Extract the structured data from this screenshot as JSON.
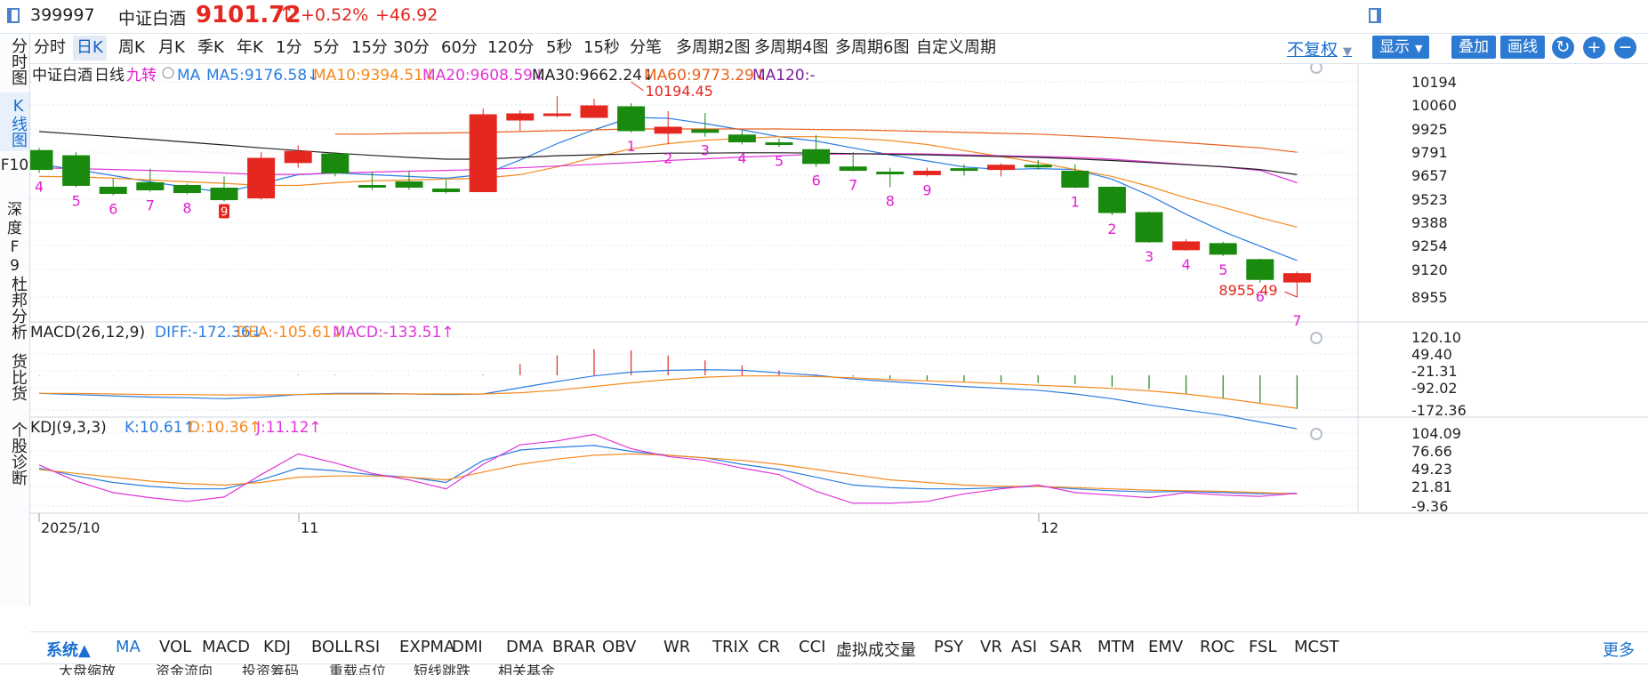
{
  "header": {
    "code": "399997",
    "name": "中证白酒",
    "price": "9101.72",
    "arrow": "↑",
    "pct": "+0.52%",
    "change": "+46.92"
  },
  "timeframes": [
    "分时",
    "日K",
    "周K",
    "月K",
    "季K",
    "年K",
    "1分",
    "5分",
    "15分",
    "30分",
    "60分",
    "120分",
    "5秒",
    "15秒",
    "分笔",
    "多周期2图",
    "多周期4图",
    "多周期6图",
    "自定义周期"
  ],
  "active_timeframe": "日K",
  "toolbar": {
    "adjust": "不复权",
    "display": "显示",
    "overlay": "叠加",
    "draw": "画线"
  },
  "sidebar": [
    {
      "label": "分时图",
      "active": false
    },
    {
      "label": "K线图",
      "active": true
    },
    {
      "label": "F10",
      "active": false
    },
    {
      "label": "深度F9",
      "active": false
    },
    {
      "label": "杜邦分析",
      "active": false
    },
    {
      "label": "货比货",
      "active": false
    },
    {
      "label": "个股诊断",
      "active": false
    }
  ],
  "ma_legend": {
    "name": "中证白酒",
    "period": "日线",
    "sig": "九转",
    "ma": "MA",
    "ma5": "MA5:9176.58↓",
    "ma10": "MA10:9394.51↓",
    "ma20": "MA20:9608.59↓",
    "ma30": "MA30:9662.24↓",
    "ma60": "MA60:9773.29↓",
    "ma120": "MA120:-"
  },
  "macd_legend": {
    "name": "MACD(26,12,9)",
    "diff": "DIFF:-172.36↓",
    "dea": "DEA:-105.61↓",
    "macd": "MACD:-133.51↑"
  },
  "kdj_legend": {
    "name": "KDJ(9,3,3)",
    "k": "K:10.61↑",
    "d": "D:10.36↑",
    "j": "J:11.12↑"
  },
  "date_labels": [
    "2025/10",
    "11",
    "12"
  ],
  "indicator_tabs": [
    "MA",
    "VOL",
    "MACD",
    "KDJ",
    "BOLL",
    "RSI",
    "EXPMA",
    "DMI",
    "DMA",
    "BRAR",
    "OBV",
    "WR",
    "TRIX",
    "CR",
    "CCI",
    "虚拟成交量",
    "PSY",
    "VR",
    "ASI",
    "SAR",
    "MTM",
    "EMV",
    "ROC",
    "FSL",
    "MCST"
  ],
  "system_label": "系统▲",
  "more_label": "更多",
  "subtabs": [
    "大盘缩放",
    "资金流向",
    "投资筹码",
    "重载点位",
    "短线跳跌",
    "相关基金"
  ],
  "colors": {
    "up": "#e4271f",
    "down": "#1a8a0f",
    "ma5": "#2a7de1",
    "ma10": "#f58a1f",
    "ma20": "#e035d8",
    "ma30": "#222222",
    "ma60": "#e8611c",
    "ma120": "#7a1f9b",
    "nine": "#e020d0"
  },
  "chart_data": [
    {
      "type": "candlestick",
      "title": "中证白酒 日线",
      "y_ticks": [
        "10194",
        "10060",
        "9925",
        "9791",
        "9657",
        "9523",
        "9388",
        "9254",
        "9120",
        "8955"
      ],
      "ylim": [
        8900,
        10250
      ],
      "max_label": "10194.45",
      "min_label": "8955.49",
      "candles": [
        {
          "o": 9800,
          "c": 9690,
          "h": 9815,
          "l": 9670
        },
        {
          "o": 9770,
          "c": 9600,
          "h": 9790,
          "l": 9590
        },
        {
          "o": 9590,
          "c": 9555,
          "h": 9640,
          "l": 9545
        },
        {
          "o": 9615,
          "c": 9575,
          "h": 9695,
          "l": 9565
        },
        {
          "o": 9600,
          "c": 9560,
          "h": 9610,
          "l": 9550
        },
        {
          "o": 9585,
          "c": 9520,
          "h": 9650,
          "l": 9510
        },
        {
          "o": 9530,
          "c": 9755,
          "h": 9790,
          "l": 9520
        },
        {
          "o": 9730,
          "c": 9795,
          "h": 9830,
          "l": 9700
        },
        {
          "o": 9780,
          "c": 9670,
          "h": 9790,
          "l": 9650
        },
        {
          "o": 9600,
          "c": 9590,
          "h": 9675,
          "l": 9575
        },
        {
          "o": 9620,
          "c": 9590,
          "h": 9680,
          "l": 9575
        },
        {
          "o": 9580,
          "c": 9565,
          "h": 9630,
          "l": 9555
        },
        {
          "o": 9565,
          "c": 10005,
          "h": 10040,
          "l": 9565
        },
        {
          "o": 9975,
          "c": 10010,
          "h": 10030,
          "l": 9915
        },
        {
          "o": 10000,
          "c": 10010,
          "h": 10110,
          "l": 9990
        },
        {
          "o": 9990,
          "c": 10055,
          "h": 10095,
          "l": 9990
        },
        {
          "o": 10050,
          "c": 9915,
          "h": 10070,
          "l": 9905
        },
        {
          "o": 9900,
          "c": 9935,
          "h": 10025,
          "l": 9835
        },
        {
          "o": 9920,
          "c": 9905,
          "h": 10015,
          "l": 9880
        },
        {
          "o": 9890,
          "c": 9850,
          "h": 9915,
          "l": 9835
        },
        {
          "o": 9845,
          "c": 9835,
          "h": 9870,
          "l": 9820
        },
        {
          "o": 9805,
          "c": 9725,
          "h": 9890,
          "l": 9705
        },
        {
          "o": 9705,
          "c": 9685,
          "h": 9790,
          "l": 9680
        },
        {
          "o": 9675,
          "c": 9670,
          "h": 9700,
          "l": 9590
        },
        {
          "o": 9660,
          "c": 9680,
          "h": 9700,
          "l": 9650
        },
        {
          "o": 9695,
          "c": 9690,
          "h": 9720,
          "l": 9655
        },
        {
          "o": 9690,
          "c": 9715,
          "h": 9725,
          "l": 9650
        },
        {
          "o": 9715,
          "c": 9705,
          "h": 9745,
          "l": 9690
        },
        {
          "o": 9680,
          "c": 9590,
          "h": 9720,
          "l": 9585
        },
        {
          "o": 9590,
          "c": 9445,
          "h": 9595,
          "l": 9430
        },
        {
          "o": 9445,
          "c": 9275,
          "h": 9450,
          "l": 9270
        },
        {
          "o": 9230,
          "c": 9275,
          "h": 9290,
          "l": 9225
        },
        {
          "o": 9265,
          "c": 9205,
          "h": 9275,
          "l": 9195
        },
        {
          "o": 9175,
          "c": 9060,
          "h": 9180,
          "l": 9040
        },
        {
          "o": 9045,
          "c": 9095,
          "h": 9108,
          "l": 8955
        }
      ],
      "nine_counts": [
        "4",
        "5",
        "6",
        "7",
        "8",
        "9",
        "",
        "",
        "",
        "",
        "",
        "",
        "",
        "",
        "",
        "",
        "1",
        "2",
        "3",
        "4",
        "5",
        "6",
        "7",
        "8",
        "9",
        "",
        "",
        "",
        "1",
        "2",
        "3",
        "4",
        "5",
        "6",
        "7"
      ],
      "series": [
        {
          "name": "MA5",
          "color": "#2a7de1",
          "values": [
            9720,
            9690,
            9655,
            9620,
            9590,
            9560,
            9610,
            9660,
            9670,
            9660,
            9650,
            9640,
            9660,
            9745,
            9840,
            9920,
            9990,
            9985,
            9955,
            9920,
            9880,
            9855,
            9815,
            9775,
            9740,
            9705,
            9690,
            9695,
            9690,
            9635,
            9545,
            9435,
            9335,
            9250,
            9170
          ]
        },
        {
          "name": "MA10",
          "color": "#f58a1f",
          "values": [
            9650,
            9648,
            9640,
            9630,
            9620,
            9612,
            9600,
            9600,
            9615,
            9625,
            9630,
            9635,
            9640,
            9660,
            9705,
            9760,
            9810,
            9840,
            9860,
            9870,
            9880,
            9880,
            9872,
            9858,
            9835,
            9800,
            9765,
            9730,
            9690,
            9650,
            9595,
            9530,
            9475,
            9415,
            9360
          ]
        },
        {
          "name": "MA20",
          "color": "#e035d8",
          "values": [
            9700,
            9695,
            9690,
            9685,
            9678,
            9670,
            9660,
            9662,
            9670,
            9675,
            9680,
            9685,
            9690,
            9700,
            9710,
            9720,
            9730,
            9742,
            9752,
            9762,
            9770,
            9778,
            9780,
            9782,
            9780,
            9775,
            9770,
            9765,
            9760,
            9750,
            9735,
            9720,
            9705,
            9685,
            9615
          ]
        },
        {
          "name": "MA30",
          "color": "#222222",
          "values": [
            9910,
            9895,
            9880,
            9865,
            9848,
            9832,
            9815,
            9800,
            9785,
            9772,
            9760,
            9750,
            9750,
            9760,
            9770,
            9775,
            9780,
            9785,
            9785,
            9787,
            9787,
            9785,
            9782,
            9778,
            9775,
            9770,
            9765,
            9760,
            9752,
            9742,
            9730,
            9718,
            9706,
            9690,
            9660
          ]
        },
        {
          "name": "MA60",
          "color": "#e8611c",
          "values": [
            null,
            null,
            null,
            null,
            null,
            null,
            null,
            null,
            9895,
            9895,
            9900,
            9902,
            9905,
            9910,
            9915,
            9920,
            9925,
            9925,
            9925,
            9925,
            9925,
            9922,
            9920,
            9915,
            9910,
            9905,
            9900,
            9895,
            9885,
            9875,
            9860,
            9845,
            9830,
            9815,
            9790
          ]
        }
      ]
    },
    {
      "type": "bar",
      "title": "MACD(26,12,9)",
      "y_ticks": [
        "120.10",
        "49.40",
        "-21.31",
        "-92.02",
        "-172.36"
      ],
      "ylim": [
        -200,
        140
      ],
      "macd": [
        -2,
        -1,
        -1,
        -1,
        -1,
        -1,
        1,
        2,
        2,
        1,
        1,
        1,
        3,
        45,
        80,
        105,
        100,
        80,
        60,
        40,
        20,
        5,
        -5,
        -15,
        -20,
        -25,
        -28,
        -30,
        -35,
        -45,
        -55,
        -75,
        -95,
        -110,
        -135
      ],
      "series": [
        {
          "name": "DIFF",
          "color": "#2a7de1",
          "values": [
            -58,
            -62,
            -66,
            -70,
            -72,
            -75,
            -70,
            -62,
            -58,
            -58,
            -60,
            -62,
            -60,
            -40,
            -20,
            -2,
            10,
            16,
            18,
            16,
            8,
            0,
            -12,
            -20,
            -28,
            -36,
            -42,
            -48,
            -60,
            -75,
            -95,
            -112,
            -128,
            -150,
            -172
          ]
        },
        {
          "name": "DEA",
          "color": "#f58a1f",
          "values": [
            -58,
            -58,
            -60,
            -62,
            -62,
            -63,
            -63,
            -62,
            -60,
            -60,
            -60,
            -60,
            -60,
            -56,
            -48,
            -36,
            -24,
            -14,
            -6,
            -2,
            -2,
            -4,
            -8,
            -14,
            -18,
            -22,
            -27,
            -32,
            -37,
            -42,
            -50,
            -60,
            -74,
            -90,
            -106
          ]
        }
      ]
    },
    {
      "type": "line",
      "title": "KDJ(9,3,3)",
      "y_ticks": [
        "104.09",
        "76.66",
        "49.23",
        "21.81",
        "-9.36"
      ],
      "ylim": [
        -20,
        120
      ],
      "series": [
        {
          "name": "K",
          "color": "#2a7de1",
          "values": [
            50,
            38,
            28,
            22,
            18,
            18,
            32,
            50,
            46,
            40,
            36,
            28,
            62,
            78,
            82,
            85,
            76,
            70,
            66,
            56,
            48,
            36,
            24,
            20,
            18,
            18,
            20,
            22,
            18,
            15,
            13,
            14,
            12,
            10,
            11
          ]
        },
        {
          "name": "D",
          "color": "#f58a1f",
          "values": [
            48,
            42,
            36,
            30,
            26,
            24,
            28,
            36,
            38,
            38,
            36,
            32,
            44,
            56,
            64,
            70,
            72,
            70,
            66,
            62,
            56,
            48,
            40,
            32,
            28,
            24,
            22,
            22,
            20,
            18,
            16,
            15,
            14,
            12,
            10
          ]
        },
        {
          "name": "J",
          "color": "#e035d8",
          "values": [
            55,
            30,
            12,
            4,
            -2,
            5,
            40,
            72,
            58,
            42,
            32,
            18,
            56,
            86,
            92,
            102,
            80,
            68,
            62,
            50,
            40,
            14,
            -5,
            -5,
            -2,
            10,
            18,
            24,
            12,
            8,
            4,
            12,
            8,
            6,
            11
          ]
        }
      ]
    }
  ]
}
